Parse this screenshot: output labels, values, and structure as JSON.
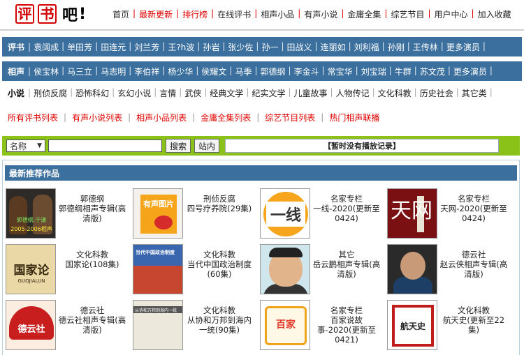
{
  "header": {
    "logo_char1": "评",
    "logo_char2": "书",
    "logo_char3": "吧",
    "logo_ex": "!",
    "nav": [
      {
        "label": "首页",
        "red": false
      },
      {
        "label": "最新更新",
        "red": true
      },
      {
        "label": "排行榜",
        "red": true
      },
      {
        "label": "在线评书",
        "red": false
      },
      {
        "label": "相声小品",
        "red": false
      },
      {
        "label": "有声小说",
        "red": false
      },
      {
        "label": "金庸全集",
        "red": false
      },
      {
        "label": "综艺节目",
        "red": false
      },
      {
        "label": "用户中心",
        "red": false
      },
      {
        "label": "加入收藏",
        "red": false
      }
    ]
  },
  "pingshu_bar": {
    "title": "评书",
    "items": [
      "袁阔成",
      "单田芳",
      "田连元",
      "刘兰芳",
      "王?h波",
      "孙岩",
      "张少佐",
      "孙一",
      "田战义",
      "连丽如",
      "刘利福",
      "孙刚",
      "王传林",
      "更多演员"
    ]
  },
  "xiangsheng_bar": {
    "title": "相声",
    "items": [
      "侯宝林",
      "马三立",
      "马志明",
      "李伯祥",
      "杨少华",
      "侯耀文",
      "马季",
      "郭德纲",
      "李金斗",
      "常宝华",
      "刘宝瑞",
      "牛群",
      "苏文茂",
      "更多演员"
    ]
  },
  "xiaoshuo_bar": {
    "title": "小说",
    "items": [
      "刑侦反腐",
      "恐怖科幻",
      "玄幻小说",
      "言情",
      "武侠",
      "经典文学",
      "纪实文学",
      "儿童故事",
      "人物传记",
      "文化科教",
      "历史社会",
      "其它类"
    ]
  },
  "list_links": [
    "所有评书列表",
    "有声小说列表",
    "相声小品列表",
    "金庸全集列表",
    "综艺节目列表",
    "热门相声联播"
  ],
  "search": {
    "select_value": "名称",
    "input_value": "",
    "search_button": "搜索",
    "site_button": "站内",
    "record_text": "【暂时没有播放记录】"
  },
  "recommended": {
    "title": "最新推荐作品",
    "items": [
      {
        "cat": "郭德纲",
        "name": "郭德纲相声专辑(高清版)",
        "art_top": "郭德纲.于谦",
        "art_bottom": "2005-2006相声"
      },
      {
        "cat": "刑侦反腐",
        "name": "四号疗养院(29集)",
        "art_top": "有声图片",
        "art_bottom": ""
      },
      {
        "cat": "名家专栏",
        "name": "一线-2020(更新至0424)",
        "art_top": "一线",
        "art_bottom": ""
      },
      {
        "cat": "名家专栏",
        "name": "天网-2020(更新至0424)",
        "art_top": "天网",
        "art_bottom": ""
      },
      {
        "cat": "文化科教",
        "name": "国家论(108集)",
        "art_top": "国家论",
        "art_bottom": "GUOJIALUN"
      },
      {
        "cat": "文化科教",
        "name": "当代中国政治制度(60集)",
        "art_top": "当代中国政治制度",
        "art_bottom": ""
      },
      {
        "cat": "其它",
        "name": "岳云鹏相声专辑(高清版)",
        "art_top": "",
        "art_bottom": ""
      },
      {
        "cat": "德云社",
        "name": "赵云侠相声专辑(高清版)",
        "art_top": "",
        "art_bottom": ""
      },
      {
        "cat": "德云社",
        "name": "德云社相声专辑(高清版)",
        "art_top": "德云社",
        "art_bottom": ""
      },
      {
        "cat": "文化科教",
        "name": "从协和万邦到海内一统(90集)",
        "art_top": "从协和万邦到海内一统",
        "art_bottom": ""
      },
      {
        "cat": "名家专栏",
        "name": "百家说故事-2020(更新至0421)",
        "art_top": "百家",
        "art_bottom": ""
      },
      {
        "cat": "文化科教",
        "name": "航天史(更新至22集)",
        "art_top": "航天史",
        "art_bottom": ""
      }
    ]
  }
}
